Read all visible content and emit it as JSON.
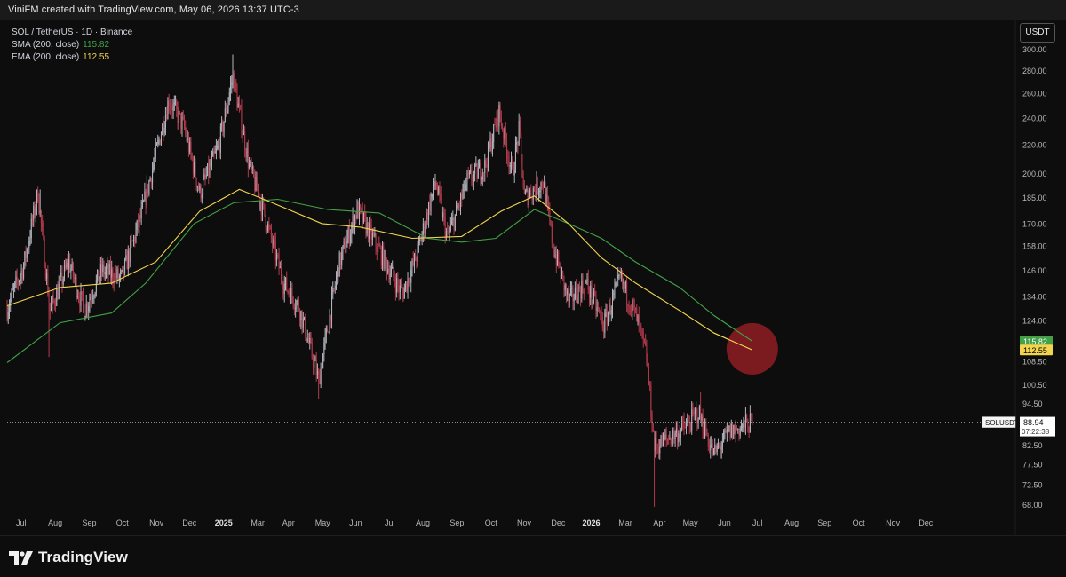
{
  "header": {
    "credit": "ViniFM created with TradingView.com, May 06, 2026 13:37 UTC-3"
  },
  "legend": {
    "symbol_line": "SOL / TetherUS · 1D · Binance",
    "sma_label": "SMA (200, close)",
    "sma_value": "115.82",
    "ema_label": "EMA (200, close)",
    "ema_value": "112.55"
  },
  "currency_button": "USDT",
  "footer": {
    "brand": "TradingView"
  },
  "colors": {
    "up": "#b2b5be",
    "down": "#b23a4c",
    "sma": "#43a047",
    "ema": "#f2d44f",
    "highlight": "#8b1c22",
    "price_line": "#9e9e9e"
  },
  "chart_data": {
    "type": "candlestick",
    "x_tick_labels": [
      "Jul",
      "Aug",
      "Sep",
      "Oct",
      "Nov",
      "Dec",
      "2025",
      "Mar",
      "Apr",
      "May",
      "Jun",
      "Jul",
      "Aug",
      "Sep",
      "Oct",
      "Nov",
      "Dec",
      "2026",
      "Mar",
      "Apr",
      "May",
      "Jun",
      "Jul",
      "Aug",
      "Sep",
      "Oct",
      "Nov",
      "Dec"
    ],
    "y_tick_labels": [
      "300.00",
      "280.00",
      "260.00",
      "240.00",
      "220.00",
      "200.00",
      "185.00",
      "170.00",
      "158.00",
      "146.00",
      "134.00",
      "124.00",
      "108.50",
      "100.50",
      "94.50",
      "82.50",
      "77.50",
      "72.50",
      "68.00"
    ],
    "y_tick_values": [
      300,
      280,
      260,
      240,
      220,
      200,
      185,
      170,
      158,
      146,
      134,
      124,
      108.5,
      100.5,
      94.5,
      82.5,
      77.5,
      72.5,
      68
    ],
    "y_scale": "log",
    "ylim": [
      66.5,
      305
    ],
    "xlim": [
      "2024-06-28",
      "2026-12-31"
    ],
    "price_anchors": [
      [
        "2024-06-28",
        129
      ],
      [
        "2024-07-13",
        148
      ],
      [
        "2024-07-26",
        188
      ],
      [
        "2024-08-06",
        128
      ],
      [
        "2024-08-23",
        150
      ],
      [
        "2024-09-06",
        128
      ],
      [
        "2024-09-22",
        146
      ],
      [
        "2024-10-10",
        142
      ],
      [
        "2024-10-28",
        175
      ],
      [
        "2024-11-22",
        255
      ],
      [
        "2024-12-06",
        232
      ],
      [
        "2024-12-20",
        188
      ],
      [
        "2025-01-06",
        218
      ],
      [
        "2025-01-19",
        275
      ],
      [
        "2025-02-03",
        205
      ],
      [
        "2025-02-17",
        175
      ],
      [
        "2025-03-06",
        140
      ],
      [
        "2025-03-20",
        130
      ],
      [
        "2025-04-07",
        102
      ],
      [
        "2025-04-25",
        148
      ],
      [
        "2025-05-12",
        178
      ],
      [
        "2025-05-30",
        158
      ],
      [
        "2025-06-22",
        135
      ],
      [
        "2025-07-05",
        153
      ],
      [
        "2025-07-22",
        195
      ],
      [
        "2025-08-02",
        162
      ],
      [
        "2025-08-20",
        195
      ],
      [
        "2025-09-05",
        205
      ],
      [
        "2025-09-18",
        245
      ],
      [
        "2025-09-30",
        200
      ],
      [
        "2025-10-06",
        230
      ],
      [
        "2025-10-11",
        185
      ],
      [
        "2025-10-28",
        195
      ],
      [
        "2025-11-06",
        158
      ],
      [
        "2025-11-20",
        132
      ],
      [
        "2025-12-06",
        140
      ],
      [
        "2025-12-22",
        122
      ],
      [
        "2026-01-06",
        142
      ],
      [
        "2026-01-20",
        126
      ],
      [
        "2026-01-30",
        110
      ],
      [
        "2026-02-06",
        82
      ],
      [
        "2026-02-22",
        85
      ],
      [
        "2026-03-08",
        88
      ],
      [
        "2026-03-18",
        92
      ],
      [
        "2026-04-01",
        80
      ],
      [
        "2026-04-15",
        86
      ],
      [
        "2026-05-06",
        88.94
      ]
    ],
    "wick_extremes": [
      [
        "2024-08-05",
        110
      ],
      [
        "2024-07-28",
        190
      ],
      [
        "2025-01-19",
        295
      ],
      [
        "2025-04-07",
        96
      ],
      [
        "2025-09-18",
        253
      ],
      [
        "2026-02-06",
        67.5
      ],
      [
        "2026-03-20",
        98
      ]
    ],
    "sma_200": [
      [
        "2024-06-28",
        108
      ],
      [
        "2024-08-15",
        123
      ],
      [
        "2024-10-01",
        127
      ],
      [
        "2024-11-01",
        140
      ],
      [
        "2024-12-15",
        170
      ],
      [
        "2025-01-20",
        182
      ],
      [
        "2025-03-01",
        184
      ],
      [
        "2025-04-15",
        178
      ],
      [
        "2025-06-01",
        176
      ],
      [
        "2025-07-15",
        162
      ],
      [
        "2025-08-15",
        160
      ],
      [
        "2025-09-15",
        162
      ],
      [
        "2025-10-20",
        178
      ],
      [
        "2025-11-20",
        170
      ],
      [
        "2025-12-20",
        162
      ],
      [
        "2026-01-20",
        150
      ],
      [
        "2026-03-01",
        138
      ],
      [
        "2026-04-01",
        126
      ],
      [
        "2026-05-06",
        115.82
      ]
    ],
    "ema_200": [
      [
        "2024-06-28",
        130
      ],
      [
        "2024-08-15",
        138
      ],
      [
        "2024-10-01",
        140
      ],
      [
        "2024-11-10",
        150
      ],
      [
        "2024-12-20",
        177
      ],
      [
        "2025-01-25",
        190
      ],
      [
        "2025-02-20",
        183
      ],
      [
        "2025-04-10",
        170
      ],
      [
        "2025-05-15",
        168
      ],
      [
        "2025-07-01",
        162
      ],
      [
        "2025-08-15",
        163
      ],
      [
        "2025-09-20",
        177
      ],
      [
        "2025-10-20",
        186
      ],
      [
        "2025-11-20",
        170
      ],
      [
        "2025-12-20",
        152
      ],
      [
        "2026-01-20",
        140
      ],
      [
        "2026-03-01",
        128
      ],
      [
        "2026-04-01",
        119
      ],
      [
        "2026-05-06",
        112.55
      ]
    ],
    "last_price": {
      "symbol": "SOLUSDT",
      "value": 88.94,
      "label": "88.94",
      "countdown": "07:22:38"
    },
    "sma_badge": {
      "label": "115.82",
      "value": 115.82
    },
    "ema_badge": {
      "label": "112.55",
      "value": 112.55
    },
    "highlight_circle": {
      "date": "2026-05-06",
      "value": 113
    }
  }
}
